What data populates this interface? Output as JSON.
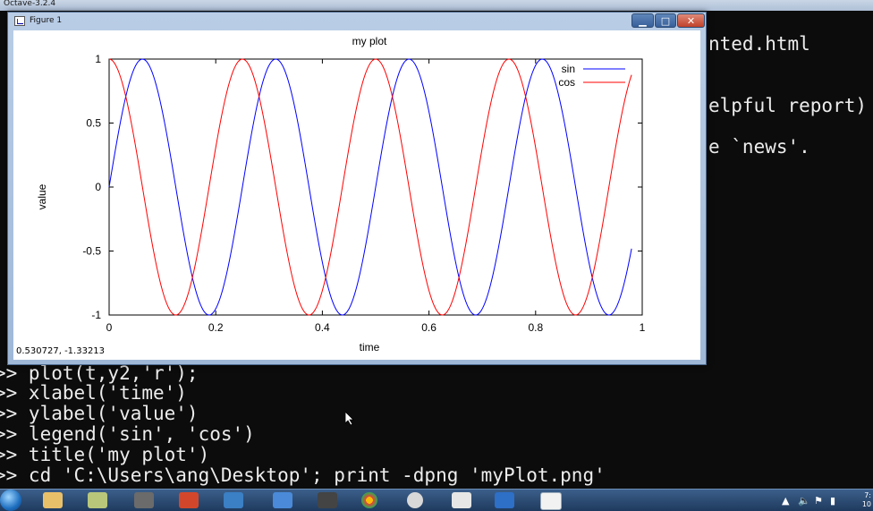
{
  "octave_window": {
    "title": "Octave-3.2.4"
  },
  "console": {
    "background_lines": [
      {
        "text": "nted.html",
        "x": 0,
        "y": 0
      },
      {
        "text": "elpful report)",
        "x": 0,
        "y": 0
      },
      {
        "text": "e `news'.",
        "x": 0,
        "y": 0
      }
    ],
    "lines": [
      ">> plot(t,y2,'r');",
      ">> xlabel('time')",
      ">> ylabel('value')",
      ">> legend('sin', 'cos')",
      ">> title('my plot')",
      ">> cd 'C:\\Users\\ang\\Desktop'; print -dpng 'myPlot.png'"
    ]
  },
  "figure": {
    "window_title": "Figure 1",
    "min_glyph": "▁",
    "max_glyph": "□",
    "close_glyph": "✕",
    "coord_readout": "0.530727, -1.33213"
  },
  "chart_data": {
    "type": "line",
    "title": "my plot",
    "xlabel": "time",
    "ylabel": "value",
    "xlim": [
      0,
      1
    ],
    "ylim": [
      -1,
      1
    ],
    "xticks": [
      "0",
      "0.2",
      "0.4",
      "0.6",
      "0.8",
      "1"
    ],
    "yticks": [
      "1",
      "0.5",
      "0",
      "-0.5",
      "-1"
    ],
    "xtick_values": [
      0,
      0.2,
      0.4,
      0.6,
      0.8,
      1
    ],
    "ytick_values": [
      1,
      0.5,
      0,
      -0.5,
      -1
    ],
    "x_start": 0,
    "x_end": 0.98,
    "frequency": 4,
    "series": [
      {
        "name": "sin",
        "function": "sin",
        "color": "#0000ff"
      },
      {
        "name": "cos",
        "function": "cos",
        "color": "#ff0000"
      }
    ],
    "legend_position": "top-right",
    "grid": false
  },
  "taskbar": {
    "clock_time": "7:",
    "clock_date": "10"
  }
}
